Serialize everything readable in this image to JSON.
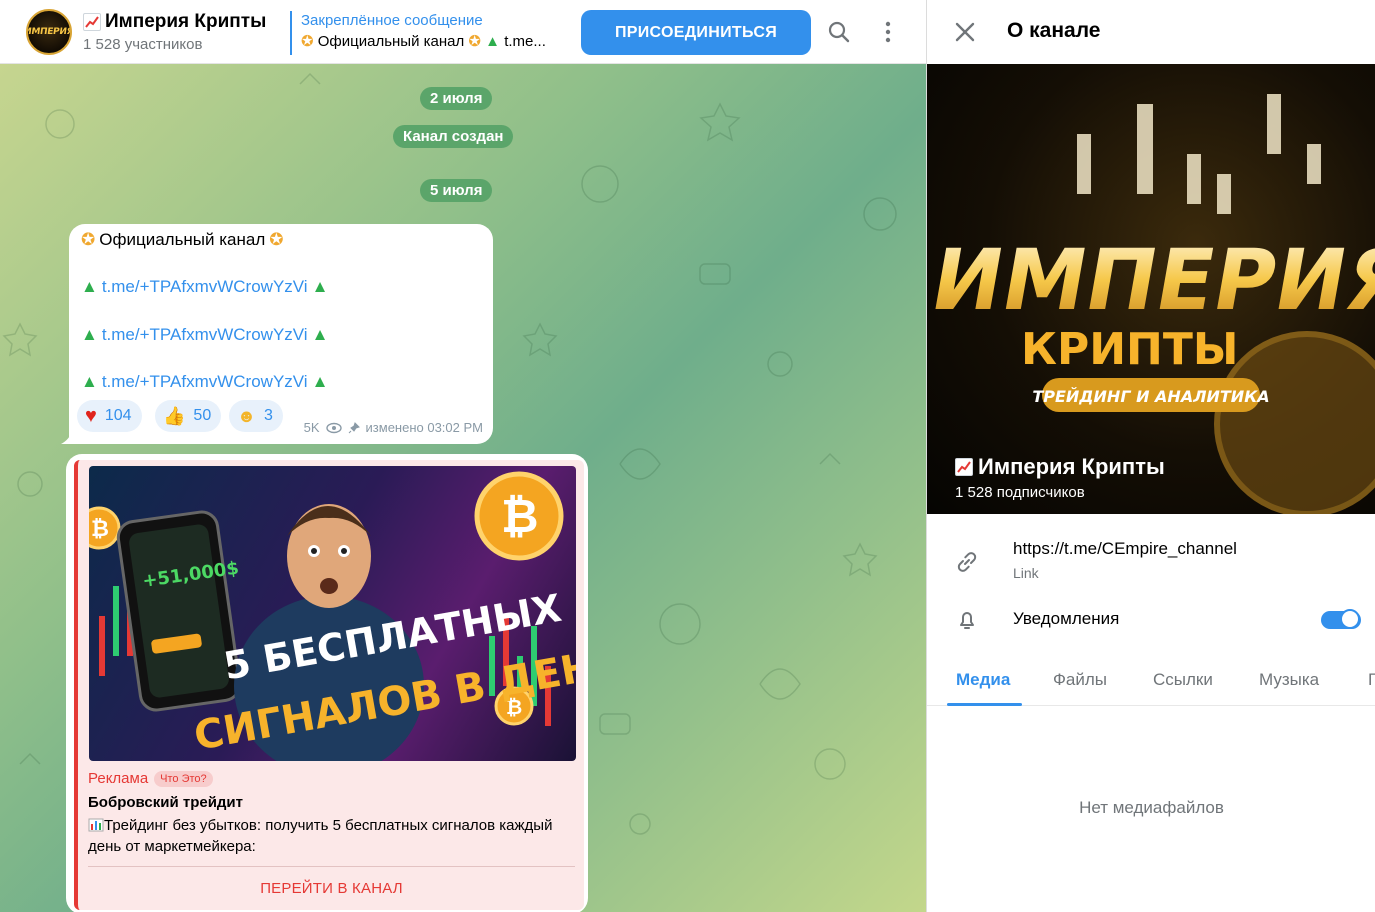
{
  "header": {
    "avatar_text": "ИМПЕРИЯ",
    "title": "Империя Крипты",
    "subtitle": "1 528 участников",
    "pinned_title": "Закреплённое сообщение",
    "pinned_text": "Официальный канал",
    "pinned_link": "t.me...",
    "join_label": "ПРИСОЕДИНИТЬСЯ",
    "icons": [
      "search-icon",
      "more-vert-icon"
    ]
  },
  "chat": {
    "dates": [
      "2 июля",
      "Канал создан",
      "5 июля"
    ],
    "message": {
      "title": "Официальный канал",
      "links": [
        "t.me/+TPAfxmvWCrowYzVi",
        "t.me/+TPAfxmvWCrowYzVi",
        "t.me/+TPAfxmvWCrowYzVi"
      ],
      "reactions": [
        {
          "emoji": "heart",
          "count": "104"
        },
        {
          "emoji": "thumbs-up",
          "count": "50"
        },
        {
          "emoji": "star-struck",
          "count": "3"
        }
      ],
      "views": "5K",
      "edited": "изменено 03:02 PM"
    },
    "ad": {
      "image_text_1": "5 БЕСПЛАТНЫХ",
      "image_text_2": "СИГНАЛОВ В ДЕНЬ!",
      "phone_amount": "+51,000$",
      "label": "Реклама",
      "what": "Что Это?",
      "title": "Бобровский трейдит",
      "text": "Трейдинг без убытков: получить 5 бесплатных сигналов каждый день от маркетмейкера:",
      "button": "ПЕРЕЙТИ В КАНАЛ"
    }
  },
  "panel": {
    "title": "О канале",
    "cover_title_1": "ИМПЕРИЯ",
    "cover_title_2": "КРИПТЫ",
    "cover_tagline": "ТРЕЙДИНГ И АНАЛИТИКА",
    "channel_name": "Империя Крипты",
    "subscribers": "1 528 подписчиков",
    "link": "https://t.me/CEmpire_channel",
    "link_caption": "Link",
    "notifications": "Уведомления",
    "notifications_on": true,
    "tabs": [
      "Медиа",
      "Файлы",
      "Ссылки",
      "Музыка",
      "Г"
    ],
    "empty": "Нет медиафайлов"
  },
  "colors": {
    "accent": "#3390ec",
    "ad_red": "#e53935",
    "date_pill": "#5ba56a"
  }
}
